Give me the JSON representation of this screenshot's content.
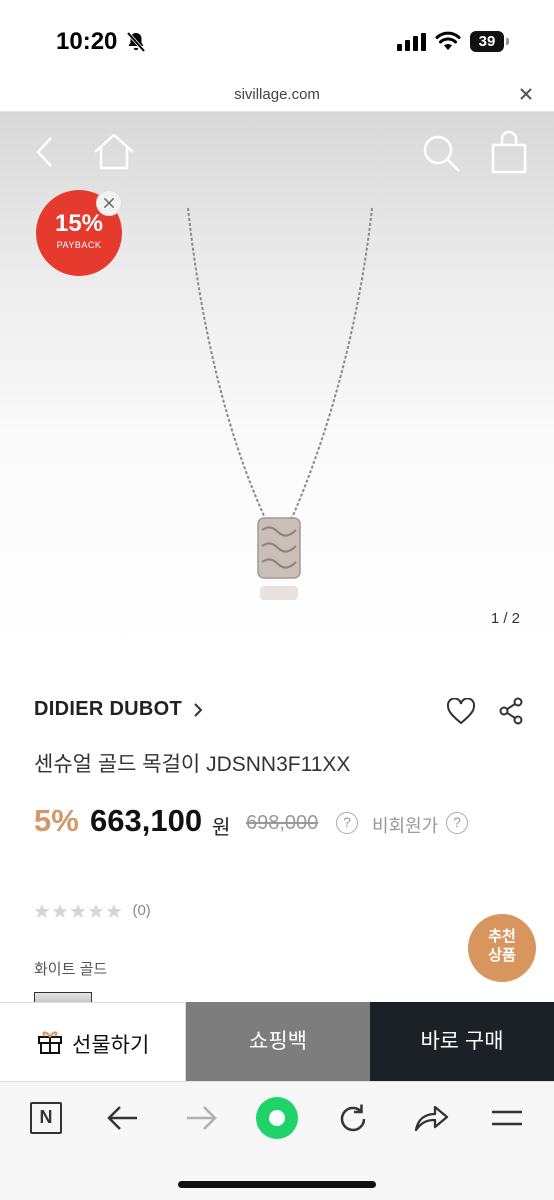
{
  "status_bar": {
    "time": "10:20",
    "battery": "39",
    "icons": [
      "bell-slash-icon",
      "signal-icon",
      "wifi-icon",
      "battery-icon"
    ]
  },
  "browser": {
    "url": "sivillage.com",
    "close_icon": "close-icon"
  },
  "header_nav": {
    "icons": [
      "back-arrow-icon",
      "home-icon",
      "search-icon",
      "shopping-bag-icon"
    ]
  },
  "payback_badge": {
    "percent": "15%",
    "label": "PAYBACK",
    "color": "#e73a2e"
  },
  "gallery": {
    "indicator": "1 / 2"
  },
  "product": {
    "brand": "DIDIER DUBOT",
    "title": "센슈얼 골드 목걸이 JDSNN3F11XX",
    "discount": "5%",
    "price": "663,100",
    "currency": "원",
    "original_price": "698,000",
    "question_mark": "?",
    "member_price_label": "비회원가",
    "rating": {
      "stars": 0,
      "max_stars": 5,
      "count": "(0)"
    },
    "color_option_label": "화이트 골드"
  },
  "recommend_button": {
    "line1": "추천",
    "line2": "상품",
    "color": "#d9955e"
  },
  "purchase_bar": {
    "gift_label": "선물하기",
    "cart_label": "쇼핑백",
    "buy_now_label": "바로 구매"
  },
  "toolbar": {
    "n_label": "N",
    "icons": [
      "naver-n-icon",
      "back-icon",
      "forward-icon",
      "green-dot-icon",
      "reload-icon",
      "share-icon",
      "menu-icon"
    ]
  },
  "colors": {
    "accent_discount": "#d4966b",
    "cart_bg": "#7d7d7d",
    "buy_bg": "#1c2027",
    "green": "#1ed36a"
  }
}
